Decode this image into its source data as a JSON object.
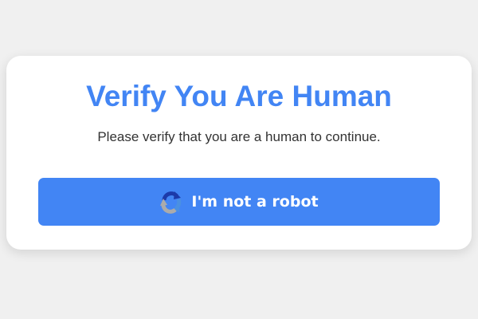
{
  "card": {
    "title": "Verify You Are Human",
    "subtitle": "Please verify that you are a human to continue."
  },
  "verify_button": {
    "label": "I'm not a robot",
    "icon": "recaptcha-icon"
  },
  "colors": {
    "accent": "#4285f4",
    "background": "#f0f0f0",
    "card": "#ffffff",
    "text": "#333333"
  }
}
